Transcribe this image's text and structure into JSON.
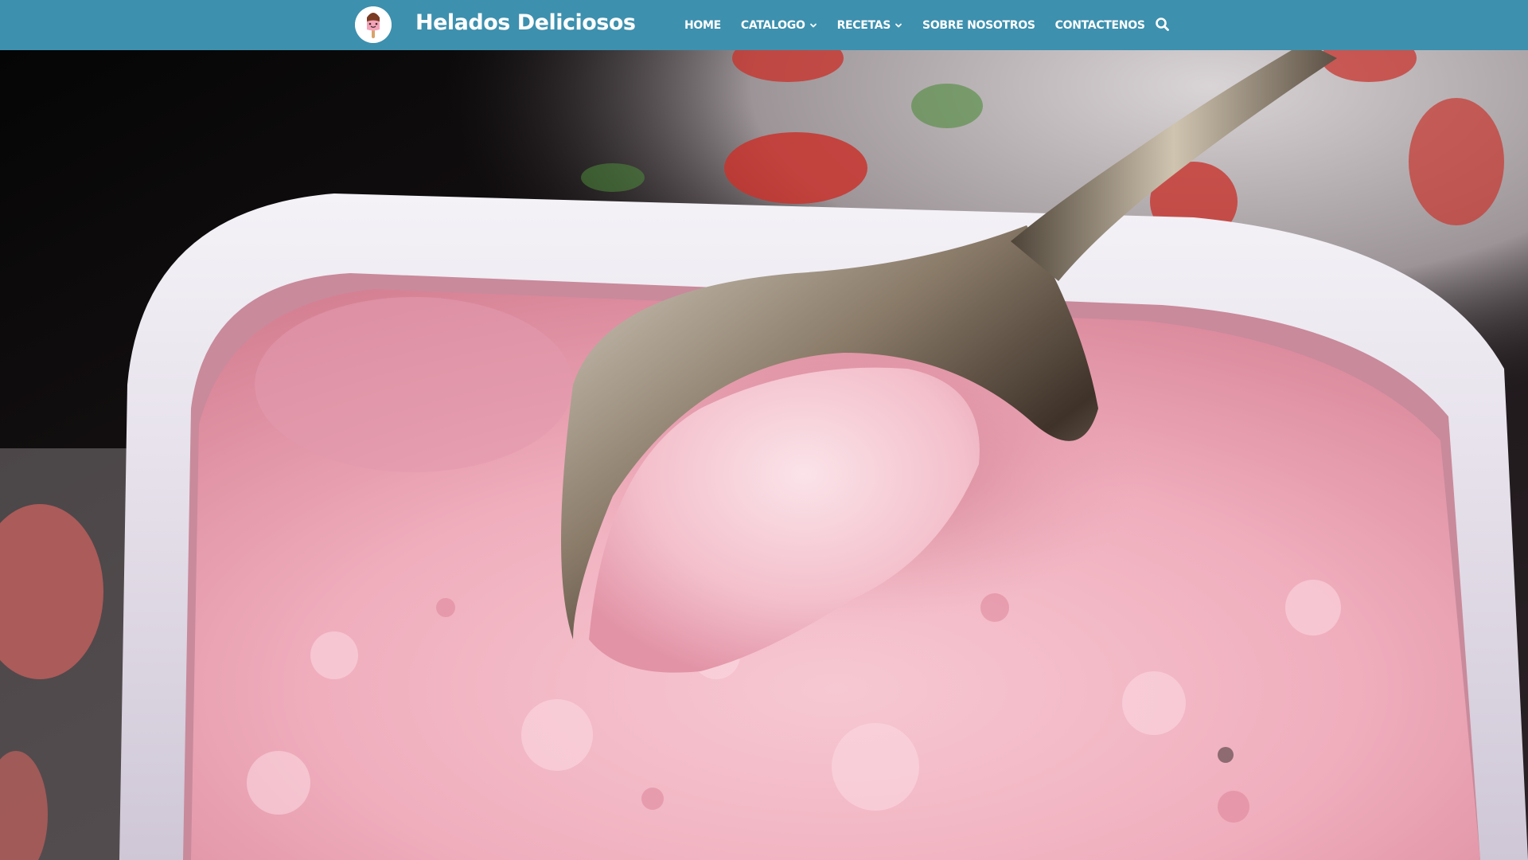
{
  "site": {
    "brand_name": "Helados Deliciosos",
    "brand_color": "#3d90ae"
  },
  "nav": {
    "items": [
      {
        "label": "HOME",
        "has_dropdown": false
      },
      {
        "label": "CATALOGO",
        "has_dropdown": true
      },
      {
        "label": "RECETAS",
        "has_dropdown": true
      },
      {
        "label": "SOBRE NOSOTROS",
        "has_dropdown": false
      },
      {
        "label": "CONTACTENOS",
        "has_dropdown": false
      }
    ],
    "search_icon": "search-icon",
    "dropdown_icon": "chevron-down-icon"
  },
  "hero": {
    "image_subject": "strawberry ice cream with spoon"
  }
}
